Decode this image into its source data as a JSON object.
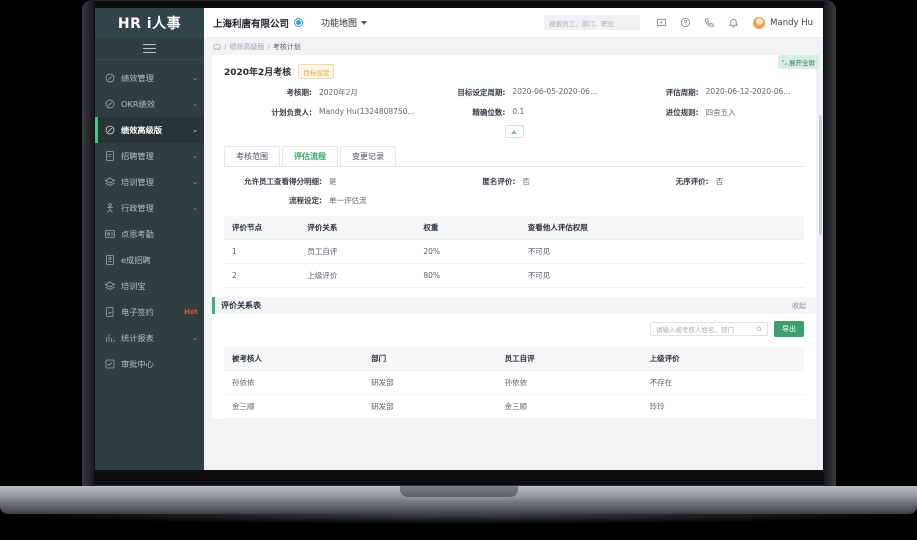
{
  "sidebar": {
    "logo": "HR i人事",
    "menu_icon": "hamburger-icon",
    "items": [
      {
        "label": "绩效管理",
        "icon": "target-icon",
        "chevron": "⌄",
        "active": false,
        "hot": ""
      },
      {
        "label": "OKR绩效",
        "icon": "target-icon",
        "chevron": "⌄",
        "active": false,
        "hot": ""
      },
      {
        "label": "绩效高级版",
        "icon": "target-icon",
        "chevron": "⌄",
        "active": true,
        "hot": ""
      },
      {
        "label": "招聘管理",
        "icon": "document-icon",
        "chevron": "⌄",
        "active": false,
        "hot": ""
      },
      {
        "label": "培训管理",
        "icon": "layers-icon",
        "chevron": "⌄",
        "active": false,
        "hot": ""
      },
      {
        "label": "行政管理",
        "icon": "person-icon",
        "chevron": "⌄",
        "active": false,
        "hot": ""
      },
      {
        "label": "点恩考勤",
        "icon": "clock-icon",
        "chevron": "",
        "active": false,
        "hot": ""
      },
      {
        "label": "e成招聘",
        "icon": "document-icon",
        "chevron": "",
        "active": false,
        "hot": ""
      },
      {
        "label": "培训宝",
        "icon": "layers-icon",
        "chevron": "",
        "active": false,
        "hot": ""
      },
      {
        "label": "电子签约",
        "icon": "signature-icon",
        "chevron": "",
        "active": false,
        "hot": "Hot"
      },
      {
        "label": "统计报表",
        "icon": "chart-icon",
        "chevron": "⌄",
        "active": false,
        "hot": ""
      },
      {
        "label": "审批中心",
        "icon": "approval-icon",
        "chevron": "",
        "active": false,
        "hot": ""
      }
    ]
  },
  "topbar": {
    "company": "上海利唐有限公司",
    "globe_icon": "globe-icon",
    "function_map": "功能地图",
    "search_placeholder": "搜索员工、部门、职位",
    "icons": [
      "video-icon",
      "help-icon",
      "phone-icon",
      "bell-icon"
    ],
    "avatar": "user-avatar",
    "username": "Mandy Hu"
  },
  "breadcrumb": {
    "home_icon": "home-icon",
    "items": [
      "绩效高级版",
      "考核计划"
    ]
  },
  "expand_button": {
    "label": "展开全屏",
    "icon": "expand-icon"
  },
  "plan": {
    "title": "2020年2月考核",
    "status_badge": "目标设定",
    "fields": [
      {
        "label": "考核期:",
        "value": "2020年2月"
      },
      {
        "label": "目标设定周期:",
        "value": "2020-06-05-2020-06..."
      },
      {
        "label": "评估周期:",
        "value": "2020-06-12-2020-06..."
      },
      {
        "label": "计划负责人:",
        "value": "Mandy Hu(1324808750..."
      },
      {
        "label": "精确位数:",
        "value": "0.1"
      },
      {
        "label": "进位规则:",
        "value": "四舍五入"
      }
    ],
    "collapse_icon": "chevron-up-icon"
  },
  "tabs": [
    {
      "label": "考核范围",
      "active": false
    },
    {
      "label": "评估流程",
      "active": true
    },
    {
      "label": "变更记录",
      "active": false
    }
  ],
  "flow": {
    "fields": [
      {
        "label": "允许员工查看得分明细:",
        "value": "是"
      },
      {
        "label": "匿名评价:",
        "value": "否"
      },
      {
        "label": "无序评价:",
        "value": "否"
      },
      {
        "label": "流程设定:",
        "value": "单一评估流"
      }
    ]
  },
  "node_table": {
    "headers": [
      "评价节点",
      "评价关系",
      "权重",
      "查看他人评估权限"
    ],
    "rows": [
      [
        "1",
        "员工自评",
        "20%",
        "不可见"
      ],
      [
        "2",
        "上级评价",
        "80%",
        "不可见"
      ]
    ]
  },
  "relation_section": {
    "title": "评价关系表",
    "collapse_label": "收起",
    "search_placeholder": "请输入被考核人姓名、部门",
    "search_icon": "search-icon",
    "export_label": "导出"
  },
  "relation_table": {
    "headers": [
      "被考核人",
      "部门",
      "员工自评",
      "上级评价"
    ],
    "rows": [
      [
        "孙依依",
        "研发部",
        "孙依依",
        "不存在"
      ],
      [
        "金三顺",
        "研发部",
        "金三顺",
        "玲玲"
      ]
    ]
  },
  "colors": {
    "sidebar_bg": "#2f3e3e",
    "accent_green": "#3fae7c",
    "badge_orange": "#e8a33d",
    "hot_red": "#e0523c",
    "active_bar": "#3ecf8e"
  }
}
